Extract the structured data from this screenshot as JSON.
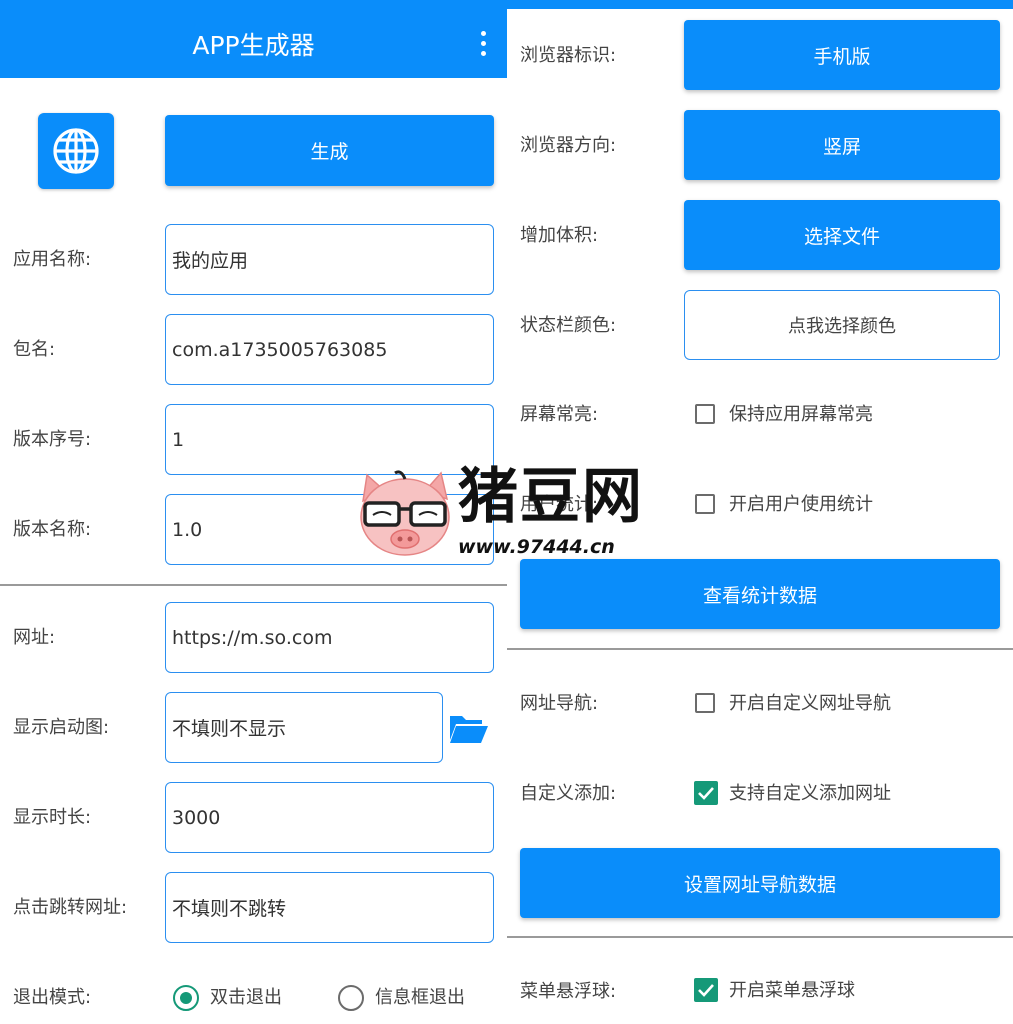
{
  "app": {
    "title": "APP生成器",
    "colors": {
      "primary": "#0a8dfa",
      "field_border": "#2b8ff0",
      "checked": "#159978",
      "divider": "#9a9a9a"
    }
  },
  "header": {
    "menu_icon": "more-vert-icon",
    "globe_icon": "globe-icon",
    "generate_label": "生成"
  },
  "form_basic": {
    "app_name": {
      "label": "应用名称:",
      "value": "我的应用"
    },
    "package": {
      "label": "包名:",
      "value": "com.a1735005763085"
    },
    "version_code": {
      "label": "版本序号:",
      "value": "1"
    },
    "version_name": {
      "label": "版本名称:",
      "value": "1.0"
    }
  },
  "form_web": {
    "url": {
      "label": "网址:",
      "value": "https://m.so.com"
    },
    "splash": {
      "label": "显示启动图:",
      "placeholder": "不填则不显示",
      "folder_icon": "folder-open-icon"
    },
    "splash_duration": {
      "label": "显示时长:",
      "value": "3000"
    },
    "click_url": {
      "label": "点击跳转网址:",
      "placeholder": "不填则不跳转"
    },
    "exit_mode": {
      "label": "退出模式:",
      "options": [
        {
          "label": "双击退出",
          "selected": true
        },
        {
          "label": "信息框退出",
          "selected": false
        }
      ]
    }
  },
  "form_browser": {
    "ua": {
      "label": "浏览器标识:",
      "button": "手机版"
    },
    "orientation": {
      "label": "浏览器方向:",
      "button": "竖屏"
    },
    "size": {
      "label": "增加体积:",
      "button": "选择文件"
    },
    "statusbar": {
      "label": "状态栏颜色:",
      "button": "点我选择颜色"
    },
    "screen_on": {
      "label": "屏幕常亮:",
      "checkbox": "保持应用屏幕常亮",
      "checked": false
    },
    "stats": {
      "label": "用户统计:",
      "checkbox": "开启用户使用统计",
      "checked": false
    },
    "view_stats_button": "查看统计数据"
  },
  "form_nav": {
    "url_nav": {
      "label": "网址导航:",
      "checkbox": "开启自定义网址导航",
      "checked": false
    },
    "custom_add": {
      "label": "自定义添加:",
      "checkbox": "支持自定义添加网址",
      "checked": true
    },
    "set_nav_button": "设置网址导航数据",
    "float_ball": {
      "label": "菜单悬浮球:",
      "checkbox": "开启菜单悬浮球",
      "checked": true
    }
  },
  "watermark": {
    "title": "猪豆网",
    "url": "www.97444.cn"
  }
}
